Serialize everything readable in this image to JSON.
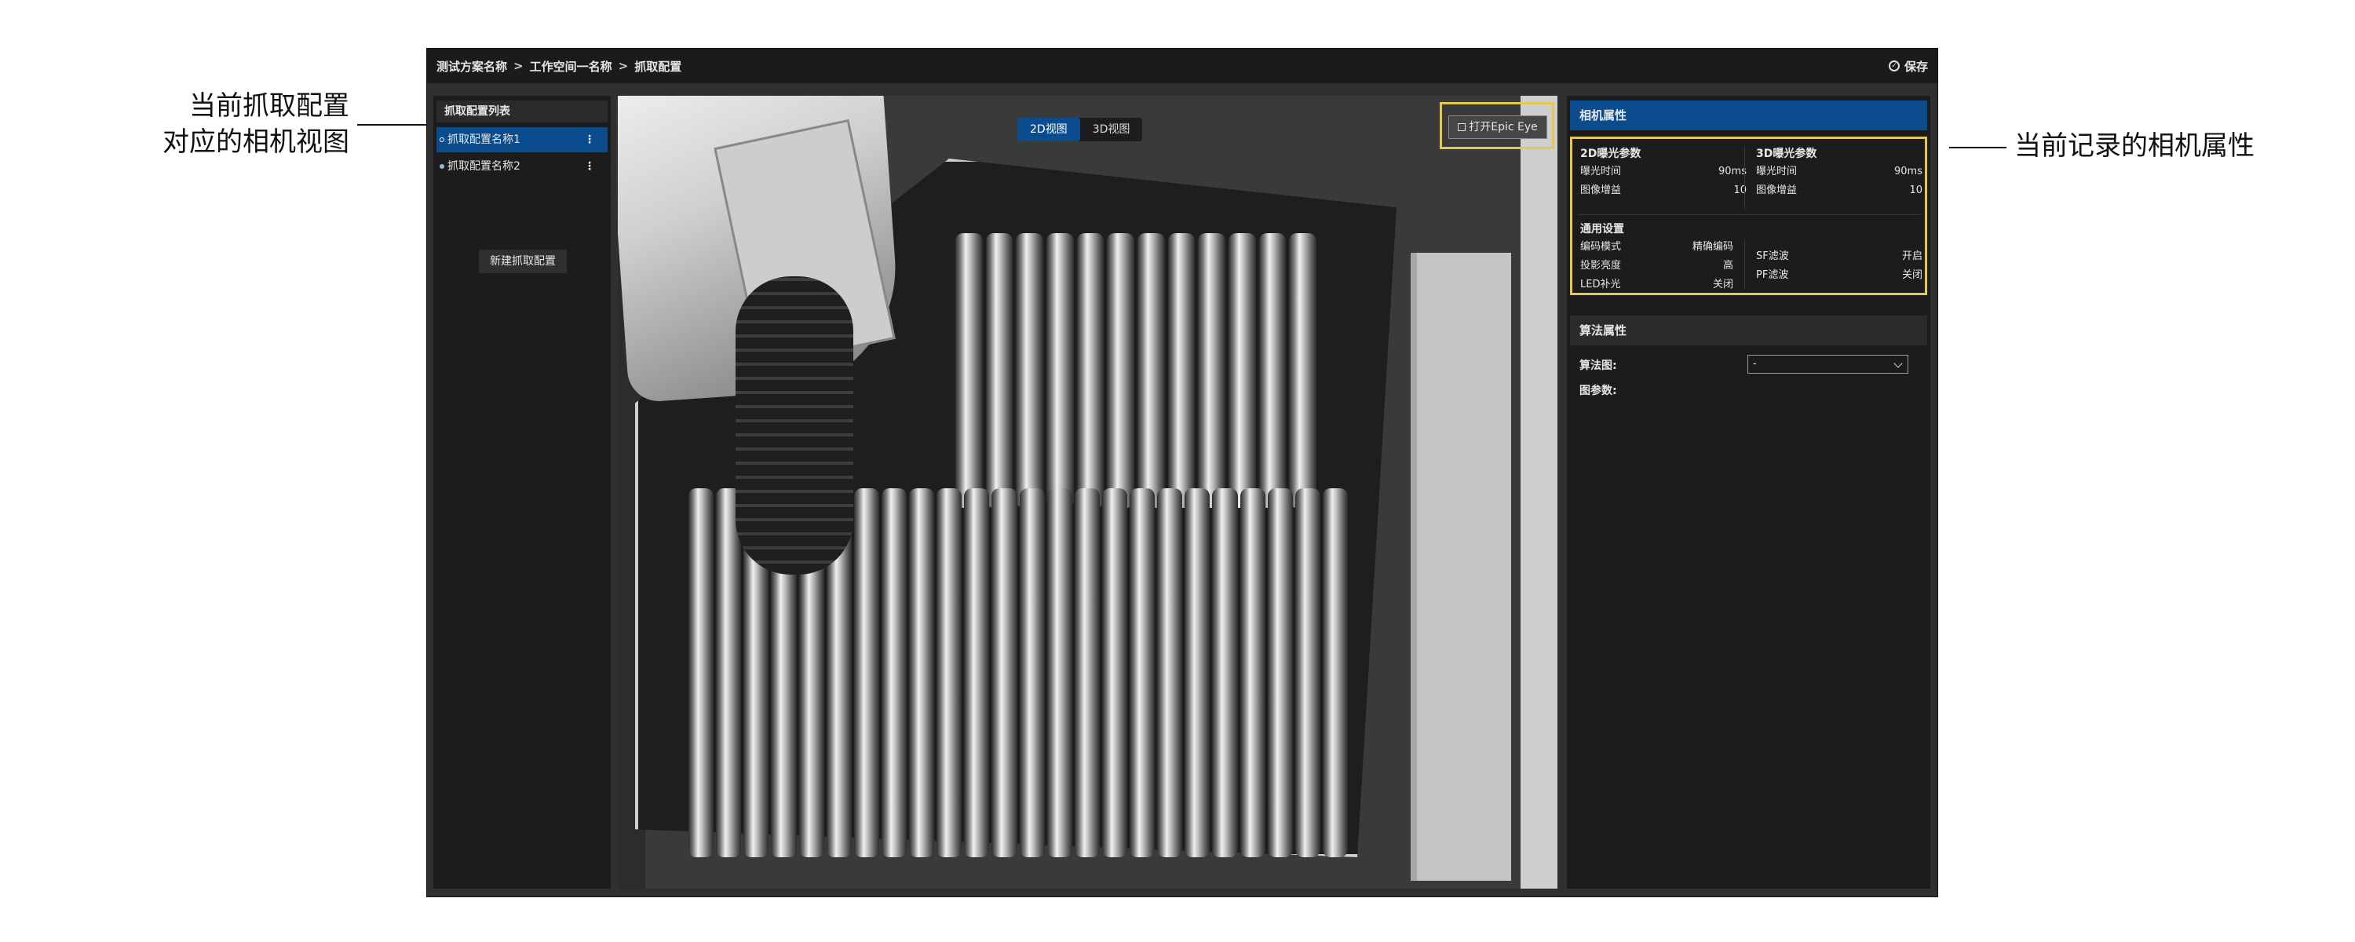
{
  "annotations": {
    "left_line1": "当前抓取配置",
    "left_line2": "对应的相机视图",
    "right": "当前记录的相机属性"
  },
  "header": {
    "breadcrumb": [
      "测试方案名称",
      "工作空间一名称",
      "抓取配置"
    ],
    "separator": ">",
    "save_label": "保存"
  },
  "left_panel": {
    "title": "抓取配置列表",
    "items": [
      {
        "label": "抓取配置名称1"
      },
      {
        "label": "抓取配置名称2"
      }
    ],
    "new_button": "新建抓取配置",
    "more_icon": "⋮"
  },
  "viewport": {
    "tabs": [
      "2D视图",
      "3D视图"
    ],
    "active_tab": "2D视图",
    "open_button": "打开Epic Eye"
  },
  "camera": {
    "title": "相机属性",
    "params_2d": {
      "title": "2D曝光参数",
      "rows": [
        {
          "label": "曝光时间",
          "value": "90ms"
        },
        {
          "label": "图像增益",
          "value": "10"
        }
      ]
    },
    "params_3d": {
      "title": "3D曝光参数",
      "rows": [
        {
          "label": "曝光时间",
          "value": "90ms"
        },
        {
          "label": "图像增益",
          "value": "10"
        }
      ]
    },
    "general": {
      "title": "通用设置",
      "left": [
        {
          "label": "编码模式",
          "value": "精确编码"
        },
        {
          "label": "投影亮度",
          "value": "高"
        },
        {
          "label": "LED补光",
          "value": "关闭"
        }
      ],
      "right": [
        {
          "label": "SF滤波",
          "value": "开启"
        },
        {
          "label": "PF滤波",
          "value": "关闭"
        }
      ]
    }
  },
  "algorithm": {
    "title": "算法属性",
    "map_label": "算法图:",
    "map_value": "-",
    "params_label": "图参数:"
  },
  "colors": {
    "accent": "#0a4c8d",
    "highlight": "#e5c84f"
  }
}
